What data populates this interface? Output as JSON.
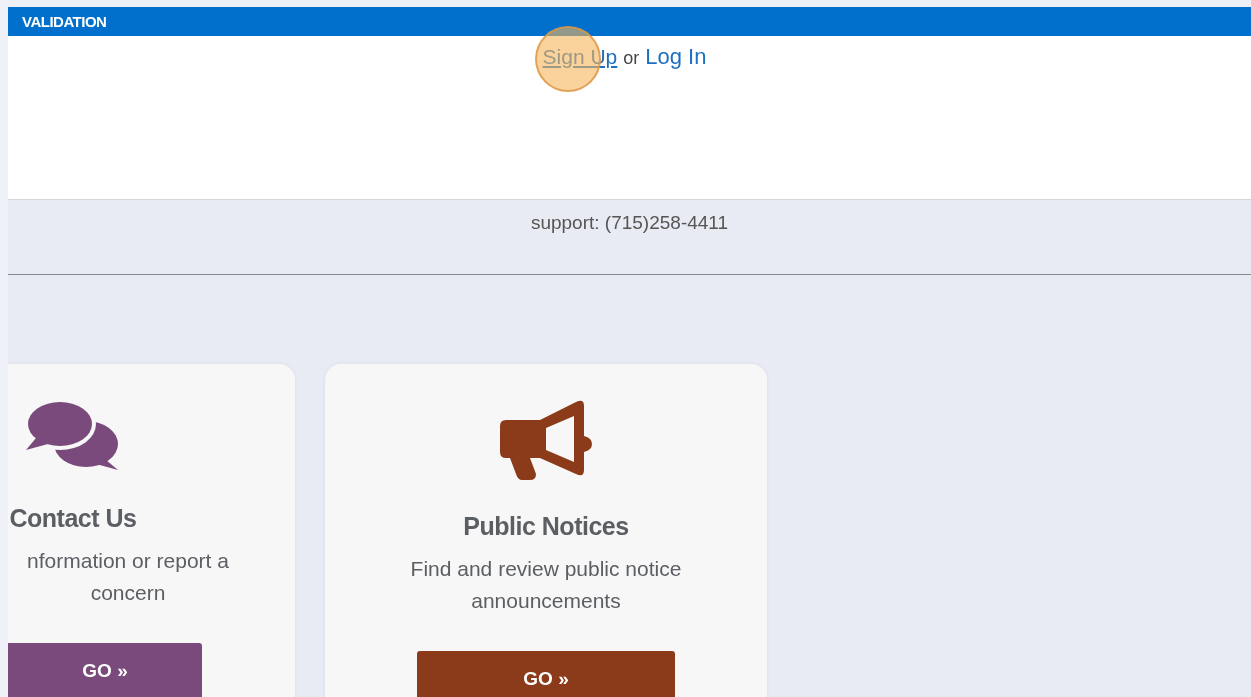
{
  "header": {
    "title": "VALIDATION"
  },
  "auth": {
    "links": [
      {
        "label": "Sign Up",
        "kind": "signup"
      },
      {
        "label": "Log In",
        "kind": "login"
      }
    ],
    "separator": "or"
  },
  "support": {
    "text": "support: (715)258-4411"
  },
  "cards": [
    {
      "title": "Contact Us",
      "description": "nformation or report a concern",
      "button": "GO »",
      "kind": "chat",
      "color": "#7b4a7d"
    },
    {
      "title": "Public Notices",
      "description": "Find and review public notice announcements",
      "button": "GO »",
      "kind": "megaphone",
      "color": "#8b3a1a"
    }
  ]
}
